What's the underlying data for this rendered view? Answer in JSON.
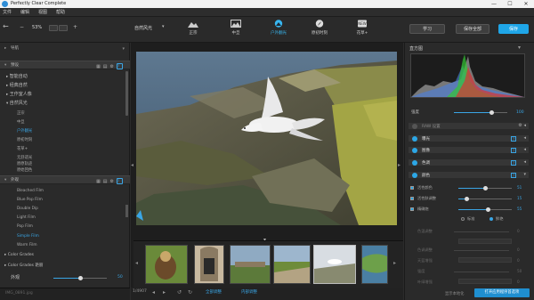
{
  "app": {
    "title": "Perfectly Clear Complete"
  },
  "window_controls": {
    "minimize": "—",
    "maximize": "☐",
    "close": "✕"
  },
  "menu": [
    "文件",
    "编辑",
    "视图",
    "帮助"
  ],
  "toolbar": {
    "zoom": "53%",
    "preset_current": "自然风光",
    "left_btn": "学习",
    "save_all": "保存全部",
    "save": "保存"
  },
  "presets": [
    {
      "label": "正宗",
      "active": false
    },
    {
      "label": "中旦",
      "active": false
    },
    {
      "label": "户外翻光",
      "active": true
    },
    {
      "label": "原初时刻",
      "active": false
    },
    {
      "label": "花草+",
      "active": false
    }
  ],
  "left": {
    "nav_header": "导航",
    "presets_header": "预设",
    "groups": [
      "智能自动",
      "经典自然",
      "王作室人像",
      "自然风光"
    ],
    "items": [
      "正宗",
      "中旦",
      "户外翻光",
      "原初时刻",
      "花草+",
      "无舒适光",
      "原原轨迹",
      "原始回色"
    ],
    "selected_item": "户外翻光",
    "looks_header": "外观",
    "looks": [
      "Bleached Film",
      "Blue Pop Film",
      "Double Dip",
      "Light Film",
      "Pop Film",
      "Simple Film",
      "Warm Film"
    ],
    "selected_look": "Simple Film",
    "color_groups": [
      "Color Grades",
      "Color Grades 艳丽"
    ],
    "strength_label": "外观",
    "strength_value": "50",
    "strength_level": 0.5,
    "status": "IMG_0891.jpg"
  },
  "filmstrip": {
    "count_label": "1/4907",
    "apply_all": "全部调整",
    "apply_current": "内部调整"
  },
  "right": {
    "histogram_title": "直方图",
    "intensity_label": "强度",
    "intensity_value": "100",
    "intensity_level": 0.7,
    "sections": [
      {
        "label": "RAW 设置",
        "on": false
      },
      {
        "label": "曝光",
        "on": true
      },
      {
        "label": "图像",
        "on": true
      },
      {
        "label": "色调",
        "on": true
      },
      {
        "label": "颜色",
        "on": true
      }
    ],
    "sliders": [
      {
        "label": "活性颜色",
        "value": "51",
        "level": 0.51
      },
      {
        "label": "活性肤调整",
        "value": "15",
        "level": 0.15
      },
      {
        "label": "精确饱",
        "value": "55",
        "level": 0.55
      }
    ],
    "radio_a": "标准",
    "radio_b": "鲜艳",
    "dim_rows": [
      "色温调整",
      "色调调整",
      "天蓝增强",
      "强度",
      "叶绿增强"
    ],
    "dim_values": [
      "0",
      "0",
      "0",
      "50",
      "0"
    ],
    "footer_note": "显示本地化",
    "footer_btn": "打开应用程序首选项"
  },
  "colors": {
    "accent": "#1fa6e8",
    "panel": "#2a2a2a",
    "header": "#383838"
  }
}
